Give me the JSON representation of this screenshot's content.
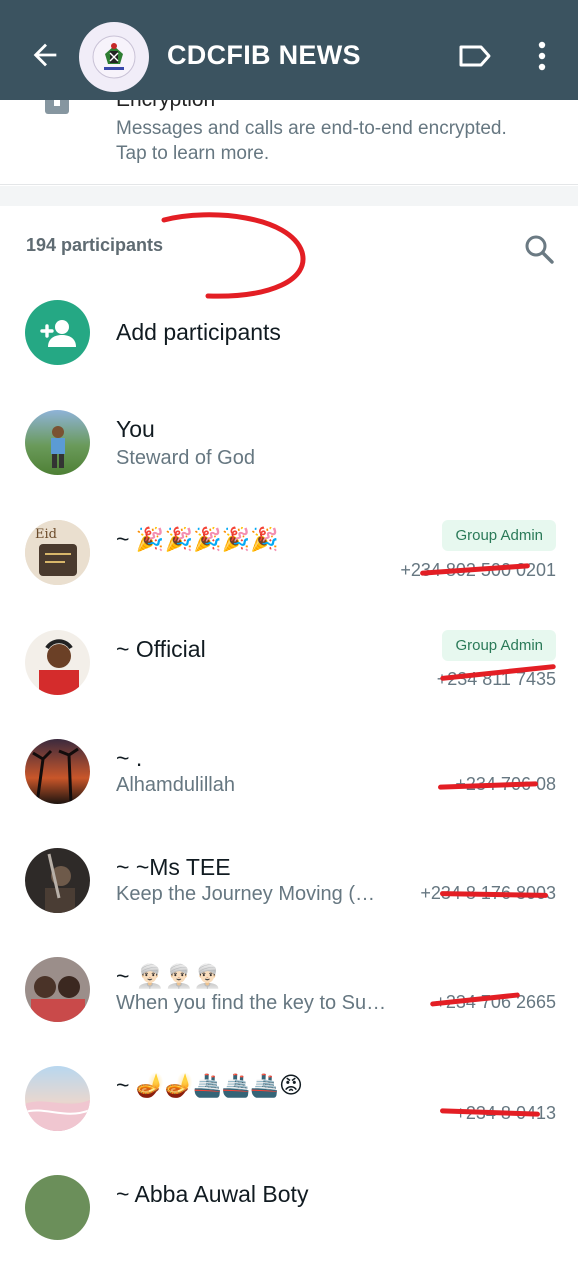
{
  "header": {
    "title": "CDCFIB NEWS",
    "back_icon": "arrow-left-icon",
    "label_icon": "label-icon",
    "more_icon": "more-vertical-icon"
  },
  "encryption": {
    "title": "Encryption",
    "description": "Messages and calls are end-to-end encrypted. Tap to learn more."
  },
  "participants": {
    "count_label": "194 participants",
    "add_label": "Add participants",
    "members": [
      {
        "name": "You",
        "status": "Steward of God",
        "phone": "",
        "badge": ""
      },
      {
        "name": "~ 🎉🎉🎉🎉🎉",
        "status": "",
        "phone": "+234 802 500 0201",
        "badge": "Group Admin"
      },
      {
        "name": "~ Official",
        "status": "",
        "phone": "+234 811 7435",
        "badge": "Group Admin"
      },
      {
        "name": "~ .",
        "status": "Alhamdulillah",
        "phone": "+234 706 08",
        "badge": ""
      },
      {
        "name": "~ ~Ms TEE",
        "status": "Keep the Journey Moving (…",
        "phone": "+234 8 176 8003",
        "badge": ""
      },
      {
        "name": "~ 👳🏻‍♂️👳🏻‍♂️👳🏻‍♂️",
        "status": "When you find the key to Su…",
        "phone": "+234 706 2665",
        "badge": ""
      },
      {
        "name": "~ 🪔🪔🚢🚢🚢😡",
        "status": "",
        "phone": "+234 8 0413",
        "badge": ""
      },
      {
        "name": "~ Abba Auwal Boty",
        "status": "",
        "phone": "",
        "badge": ""
      }
    ]
  },
  "colors": {
    "header_bg": "#3b5360",
    "accent": "#25a884",
    "badge_bg": "#e7f8ef",
    "badge_text": "#2a7a58",
    "annotation_red": "#e31e24"
  }
}
